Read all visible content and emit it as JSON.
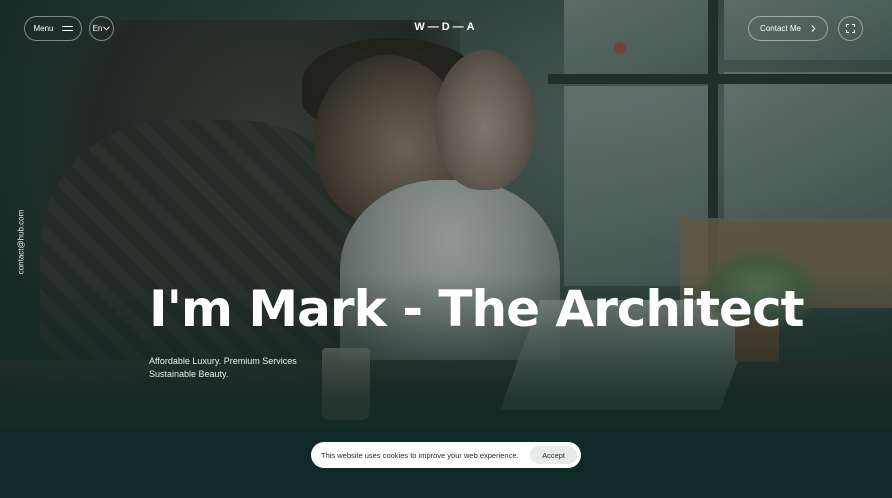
{
  "header": {
    "menu_label": "Menu",
    "language": "En",
    "logo": "W—D—A",
    "contact_label": "Contact Me"
  },
  "sidebar": {
    "email": "contact@hub.com"
  },
  "hero": {
    "title": "I'm Mark - The Architect",
    "subtitle_line1": "Affordable Luxury. Premium Services",
    "subtitle_line2": "Sustainable Beauty."
  },
  "cookie_bar": {
    "message": "This website uses cookies to improve your web experience.",
    "accept_label": "Accept"
  },
  "icons": {
    "menu": "hamburger-icon",
    "language": "chevron-down-icon",
    "contact": "chevron-right-icon",
    "expand": "expand-icon"
  },
  "colors": {
    "overlay": "#0f2926",
    "text": "#ffffff",
    "cookie_bg": "#ffffff",
    "accept_bg": "#e7ebe9"
  }
}
